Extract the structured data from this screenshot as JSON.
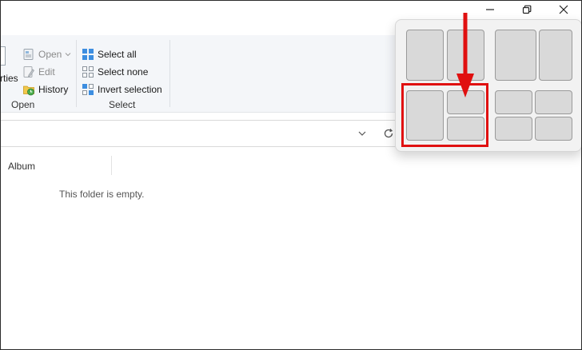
{
  "ribbon": {
    "open_group": {
      "properties_partial": "rties",
      "items": [
        "Open",
        "Edit",
        "History"
      ],
      "label": "Open"
    },
    "select_group": {
      "items": [
        "Select all",
        "Select none",
        "Invert selection"
      ],
      "label": "Select"
    }
  },
  "list": {
    "column_album": "Album",
    "empty_message": "This folder is empty."
  },
  "colors": {
    "highlight": "#e01010",
    "zone_fill": "#d9d9d9",
    "flyout_bg": "#f2f2f2"
  },
  "icons": [
    "minimize-icon",
    "restore-icon",
    "close-icon",
    "chevron-down-icon",
    "refresh-icon",
    "open-icon",
    "edit-icon",
    "history-icon",
    "select-all-icon",
    "select-none-icon",
    "invert-selection-icon"
  ]
}
